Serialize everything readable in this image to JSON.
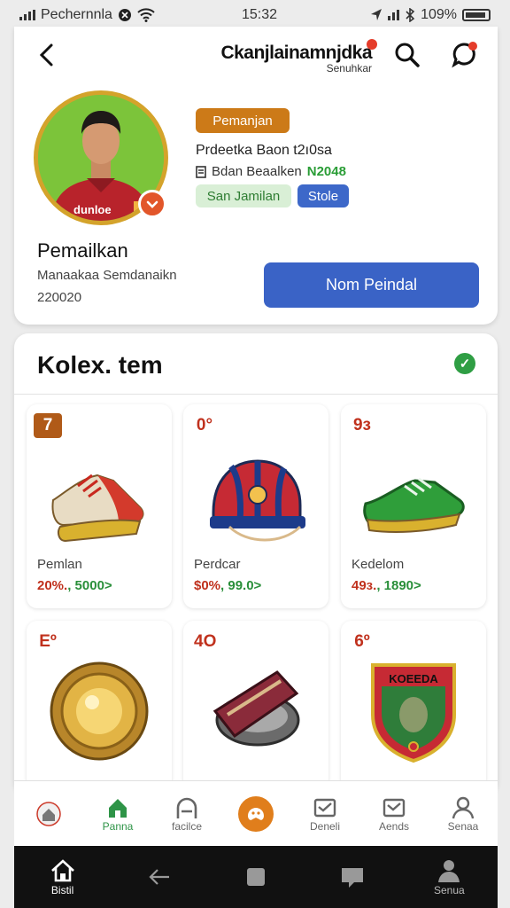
{
  "status_bar": {
    "carrier": "Pechernnla",
    "time": "15:32",
    "battery": "109%"
  },
  "header": {
    "title": "Ckanjlainamnjdka",
    "subtitle": "Senuhkar"
  },
  "profile": {
    "role_tag": "Pemanjan",
    "line1": "Prdeetka Baon t2ı0sa",
    "line2_prefix": "Bdan Beaalken",
    "line2_value": "N2048",
    "tag_green": "San Jamilan",
    "tag_blue": "Stole",
    "name": "Pemailkan",
    "description": "Manaakaa Semdanaikn",
    "number": "220020",
    "cta_label": "Nom Peindal",
    "jersey_text": "dunloe"
  },
  "collection": {
    "title": "Kolex. tem",
    "items": [
      {
        "rank": "7",
        "label": "Pemlan",
        "price_red": "20%.",
        "price_green": ", 5000>",
        "icon": "football-boots-icon"
      },
      {
        "rank": "0°",
        "label": "Perdcar",
        "price_red": "$0%",
        "price_green": ", 99.0>",
        "icon": "helmet-icon"
      },
      {
        "rank": "9з",
        "label": "Kedelom",
        "price_red": "49з.",
        "price_green": ", 1890>",
        "icon": "green-boots-icon"
      },
      {
        "rank": "Eº",
        "label": "",
        "price_red": "",
        "price_green": "",
        "icon": "gold-medal-icon"
      },
      {
        "rank": "4O",
        "label": "",
        "price_red": "",
        "price_green": "",
        "icon": "armband-icon"
      },
      {
        "rank": "6º",
        "label": "",
        "price_red": "",
        "price_green": "",
        "icon": "shield-badge-icon"
      }
    ],
    "badge_text": "KOEEDA"
  },
  "bottom_nav": {
    "items": [
      "",
      "Panna",
      "facilce",
      "",
      "Deneli",
      "Aends",
      "Senaa"
    ]
  },
  "system_nav": {
    "home_label": "Bistil",
    "profile_label": "Senua"
  },
  "colors": {
    "accent_blue": "#3a63c6",
    "accent_orange": "#cc7a18",
    "accent_green": "#2e9447",
    "red": "#c0311d"
  }
}
